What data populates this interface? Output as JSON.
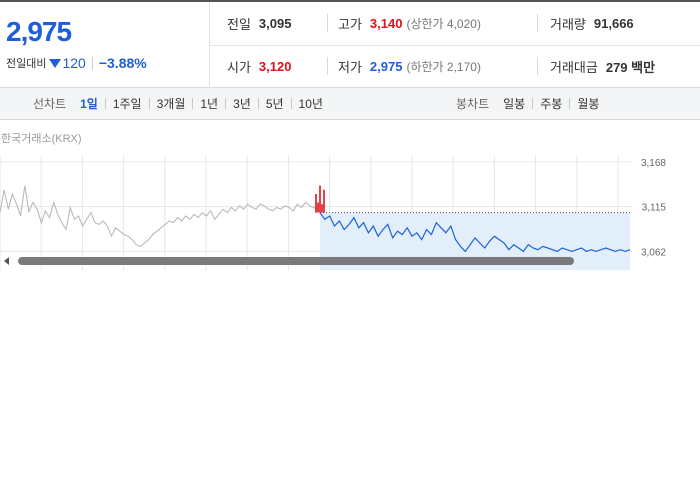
{
  "quote": {
    "price": "2,975",
    "change_label": "전일대비",
    "change_value": "120",
    "change_rate": "−3.88%",
    "stats": {
      "prev_close_label": "전일",
      "prev_close": "3,095",
      "high_label": "고가",
      "high": "3,140",
      "upper_limit": "(상한가 4,020)",
      "volume_label": "거래량",
      "volume": "91,666",
      "open_label": "시가",
      "open": "3,120",
      "low_label": "저가",
      "low": "2,975",
      "lower_limit": "(하한가 2,170)",
      "amount_label": "거래대금",
      "amount": "279 백만"
    }
  },
  "tabs": {
    "line_label": "선차트",
    "line_periods": [
      "1일",
      "1주일",
      "3개월",
      "1년",
      "3년",
      "5년",
      "10년"
    ],
    "active_period": "1일",
    "candle_label": "봉차트",
    "candle_periods": [
      "일봉",
      "주봉",
      "월봉"
    ]
  },
  "chart": {
    "source": "한국거래소(KRX)",
    "colors": {
      "prev_day": "#b5b5b5",
      "today": "#1e62d6",
      "today_fill": "#e3eefb",
      "up": "#e0101b",
      "grid": "#e6e6e6"
    }
  },
  "chart_data": {
    "type": "line",
    "title": "",
    "xlabel": "",
    "ylabel": "",
    "y_tick_labels": [
      "3,168",
      "3,115",
      "3,062"
    ],
    "ylim": [
      3040,
      3175
    ],
    "series": [
      {
        "values": [
          3108,
          3135,
          3112,
          3130,
          3118,
          3104,
          3140,
          3109,
          3120,
          3112,
          3096,
          3110,
          3102,
          3120,
          3106,
          3096,
          3088,
          3114,
          3100,
          3104,
          3092,
          3100,
          3108,
          3096,
          3094,
          3098,
          3092,
          3080,
          3090,
          3086,
          3082,
          3080,
          3076,
          3070,
          3068,
          3072,
          3076,
          3082,
          3086,
          3090,
          3094,
          3098,
          3096,
          3102,
          3098,
          3104,
          3100,
          3106,
          3102,
          3108,
          3104,
          3110,
          3100,
          3106,
          3112,
          3108,
          3114,
          3110,
          3116,
          3112,
          3118,
          3114,
          3112,
          3118,
          3116,
          3112,
          3110,
          3114,
          3112,
          3116,
          3114,
          3110,
          3118,
          3114,
          3120,
          3116,
          3114,
          3112
        ]
      },
      {
        "values": [
          3108,
          3100,
          3104,
          3092,
          3098,
          3088,
          3094,
          3102,
          3090,
          3096,
          3084,
          3092,
          3080,
          3088,
          3094,
          3078,
          3086,
          3082,
          3090,
          3080,
          3084,
          3076,
          3088,
          3082,
          3096,
          3090,
          3084,
          3092,
          3076,
          3068,
          3062,
          3070,
          3078,
          3072,
          3066,
          3074,
          3080,
          3076,
          3072,
          3064,
          3070,
          3066,
          3062,
          3070,
          3066,
          3064,
          3068,
          3066,
          3064,
          3062,
          3066,
          3064,
          3062,
          3064,
          3066,
          3062,
          3064,
          3062,
          3064,
          3066,
          3064,
          3062,
          3064,
          3062,
          3064
        ]
      },
      {
        "values": [
          3130,
          3120,
          3140,
          3118,
          3135
        ]
      }
    ]
  }
}
